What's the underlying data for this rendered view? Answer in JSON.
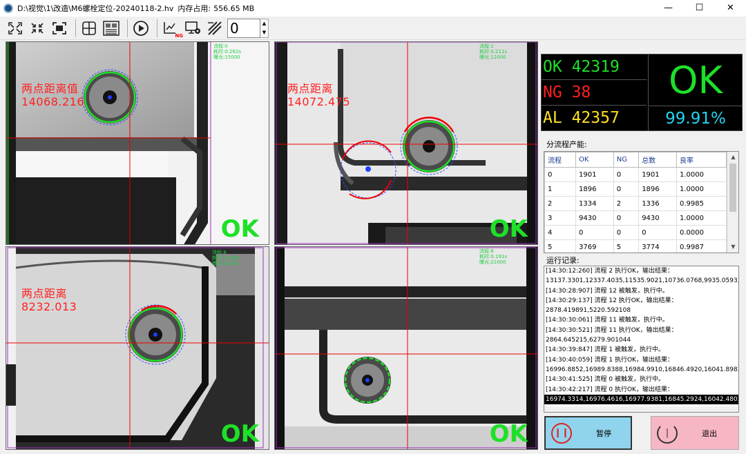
{
  "window": {
    "title": "D:\\视觉\\1\\改造\\M6螺栓定位-20240118-2.hv",
    "memory_label": "内存占用:",
    "memory_value": "556.65 MB",
    "minimize": "—",
    "maximize": "☐",
    "close": "✕"
  },
  "toolbar": {
    "icons": [
      "fit-screen-icon",
      "shrink-icon",
      "focus-frame-icon",
      "crosshair-grid-icon",
      "layout-icon",
      "run-icon",
      "ng-image-icon",
      "monitor-settings-icon",
      "line-tool-icon"
    ],
    "ng_badge": "NG",
    "counter_value": "0",
    "spin_up": "▲",
    "spin_down": "▼"
  },
  "cameras": [
    {
      "label_line1": "两点距离值",
      "label_line2": "14068.216",
      "stats": [
        "流程:0",
        "耗时:0.262s",
        "曝光:15000"
      ],
      "result": "OK"
    },
    {
      "label_line1": "两点距离",
      "label_line2": "14072.475",
      "stats": [
        "流程:1",
        "耗时:0.211s",
        "曝光:12000"
      ],
      "result": "OK"
    },
    {
      "label_line1": "两点距离",
      "label_line2": "8232.013",
      "stats": [
        "流程:8",
        "耗时:0.188s",
        "曝光:21000"
      ],
      "result": "OK"
    },
    {
      "label_line1": "",
      "label_line2": "",
      "stats": [
        "流程:8",
        "耗时:0.191s",
        "曝光:21000"
      ],
      "result": "OK"
    }
  ],
  "summary": {
    "ok_label": "OK",
    "ok_count": "42319",
    "ng_label": "NG",
    "ng_count": "38",
    "all_label": "AL",
    "all_count": "42357",
    "overall_result": "OK",
    "yield_rate": "99.91%",
    "colors": {
      "ok": "#1ee028",
      "ng": "#ff2020",
      "all": "#ffe020",
      "rate": "#22d4f0"
    }
  },
  "flow_table": {
    "title": "分流程产能:",
    "headers": [
      "流程",
      "OK",
      "NG",
      "总数",
      "良率"
    ],
    "rows": [
      [
        "0",
        "1901",
        "0",
        "1901",
        "1.0000"
      ],
      [
        "1",
        "1896",
        "0",
        "1896",
        "1.0000"
      ],
      [
        "2",
        "1334",
        "2",
        "1336",
        "0.9985"
      ],
      [
        "3",
        "9430",
        "0",
        "9430",
        "1.0000"
      ],
      [
        "4",
        "0",
        "0",
        "0",
        "0.0000"
      ],
      [
        "5",
        "3769",
        "5",
        "3774",
        "0.9987"
      ]
    ]
  },
  "log": {
    "title": "运行记录:",
    "lines": [
      "[14:30:12:260] 流程 2 执行OK，输出结果：",
      "13137.3301,12337.4035,11535.9021,10736.0768,9935.0593,913",
      "[14:30:28:907] 流程 12 被触发，执行中。",
      "[14:30:29:137] 流程 12 执行OK，输出结果：",
      "2878.419891,5220.592108",
      "[14:30:30:061] 流程 11 被触发，执行中。",
      "[14:30:30:521] 流程 11 执行OK，输出结果：",
      "2864.645215,6279.901044",
      "[14:30:39:847] 流程 1 被触发，执行中。",
      "[14:30:40:059] 流程 1 执行OK，输出结果：",
      "16996.8852,16989.8388,16984.9910,16846.4920,16041.8983,15",
      "[14:30:41:525] 流程 0 被触发，执行中。",
      "[14:30:42:217] 流程 0 执行OK，输出结果：",
      "16974.3314,16976.4616,16977.9381,16845.2924,16042.4803,15"
    ]
  },
  "buttons": {
    "pause": "暂停",
    "exit": "退出"
  }
}
